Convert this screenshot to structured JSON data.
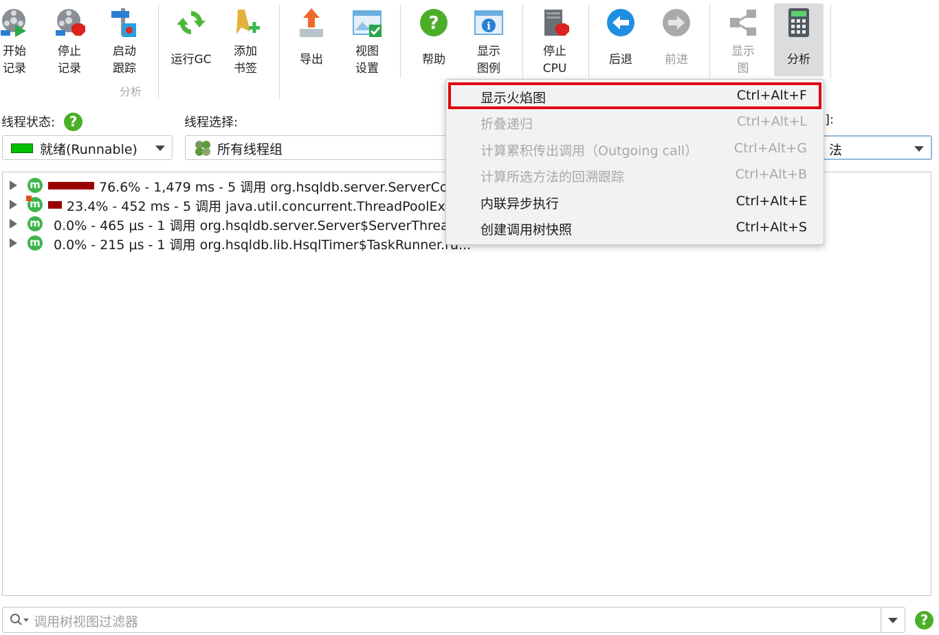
{
  "toolbar": {
    "start_record": "开始\n记录",
    "stop_record": "停止\n记录",
    "start_tracking": "启动\n跟踪",
    "run_gc": "运行GC",
    "add_bookmark": "添加\n书签",
    "export": "导出",
    "view_settings": "视图\n设置",
    "help": "帮助",
    "show_legend": "显示\n图例",
    "stop_cpu": "停止\nCPU",
    "back": "后退",
    "forward": "前进",
    "show_graph": "显示\n图",
    "analyze": "分析",
    "group_label": "分析"
  },
  "thread_status": {
    "label": "线程状态:",
    "value": "就绪(Runnable)",
    "swatch_color": "#00c000"
  },
  "thread_select": {
    "label": "线程选择:",
    "value": "所有线程组"
  },
  "aggregation": {
    "label_fragment": "]:",
    "value_fragment": "法"
  },
  "call_tree": [
    {
      "percent_bar": 76.6,
      "text": "76.6% - 1,479 ms - 5 调用 org.hsqldb.server.ServerConn"
    },
    {
      "percent_bar": 23.4,
      "text": "23.4% - 452 ms - 5 调用 java.util.concurrent.ThreadPoolExec"
    },
    {
      "percent_bar": 0,
      "text": "0.0% - 465 μs - 1 调用 org.hsqldb.server.Server$ServerThread.r"
    },
    {
      "percent_bar": 0,
      "text": "0.0% - 215 μs - 1 调用 org.hsqldb.lib.HsqlTimer$TaskRunner.ru..."
    }
  ],
  "context_menu": [
    {
      "label": "显示火焰图",
      "shortcut": "Ctrl+Alt+F",
      "enabled": true,
      "highlighted": true
    },
    {
      "label": "折叠递归",
      "shortcut": "Ctrl+Alt+L",
      "enabled": false
    },
    {
      "label": "计算累积传出调用（Outgoing call）",
      "shortcut": "Ctrl+Alt+G",
      "enabled": false
    },
    {
      "label": "计算所选方法的回溯跟踪",
      "shortcut": "Ctrl+Alt+B",
      "enabled": false
    },
    {
      "label": "内联异步执行",
      "shortcut": "Ctrl+Alt+E",
      "enabled": true
    },
    {
      "label": "创建调用树快照",
      "shortcut": "Ctrl+Alt+S",
      "enabled": true
    }
  ],
  "filter": {
    "placeholder": "调用树视图过滤器"
  },
  "icons": {
    "help": "?",
    "method": "m"
  },
  "colors": {
    "highlight_border": "#e00010",
    "bar": "#9b0000",
    "method_icon": "#3cb54a"
  }
}
